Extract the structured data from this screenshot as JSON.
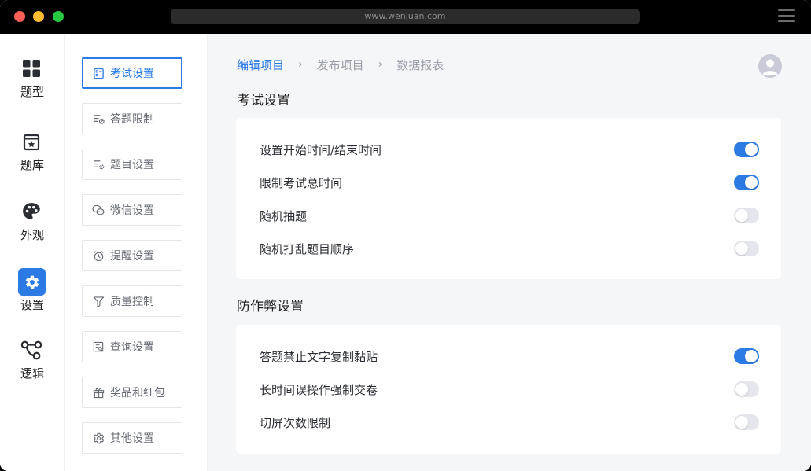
{
  "browser": {
    "url": "www.wenjuan.com"
  },
  "rail": {
    "items": [
      {
        "label": "题型",
        "icon": "grid-icon"
      },
      {
        "label": "题库",
        "icon": "bookmark-box-icon"
      },
      {
        "label": "外观",
        "icon": "palette-icon"
      },
      {
        "label": "设置",
        "icon": "gear-icon",
        "active": true
      },
      {
        "label": "逻辑",
        "icon": "logic-flow-icon"
      }
    ]
  },
  "submenu": {
    "items": [
      {
        "label": "考试设置",
        "icon": "exam-settings-icon",
        "active": true
      },
      {
        "label": "答题限制",
        "icon": "answer-limit-icon"
      },
      {
        "label": "题目设置",
        "icon": "question-settings-icon"
      },
      {
        "label": "微信设置",
        "icon": "wechat-icon"
      },
      {
        "label": "提醒设置",
        "icon": "alarm-clock-icon"
      },
      {
        "label": "质量控制",
        "icon": "filter-icon"
      },
      {
        "label": "查询设置",
        "icon": "query-icon"
      },
      {
        "label": "奖品和红包",
        "icon": "gift-icon"
      },
      {
        "label": "其他设置",
        "icon": "gear-icon"
      }
    ]
  },
  "breadcrumb": {
    "items": [
      "编辑项目",
      "发布项目",
      "数据报表"
    ],
    "separator": "›"
  },
  "sections": [
    {
      "title": "考试设置",
      "rows": [
        {
          "label": "设置开始时间/结束时间",
          "on": true
        },
        {
          "label": "限制考试总时间",
          "on": true
        },
        {
          "label": "随机抽题",
          "on": false
        },
        {
          "label": "随机打乱题目顺序",
          "on": false
        }
      ]
    },
    {
      "title": "防作弊设置",
      "rows": [
        {
          "label": "答题禁止文字复制黏贴",
          "on": true
        },
        {
          "label": "长时间误操作强制交卷",
          "on": false
        },
        {
          "label": "切屏次数限制",
          "on": false
        }
      ]
    }
  ],
  "colors": {
    "accent": "#2c7be5",
    "toggle_off": "#e4e6ec"
  }
}
